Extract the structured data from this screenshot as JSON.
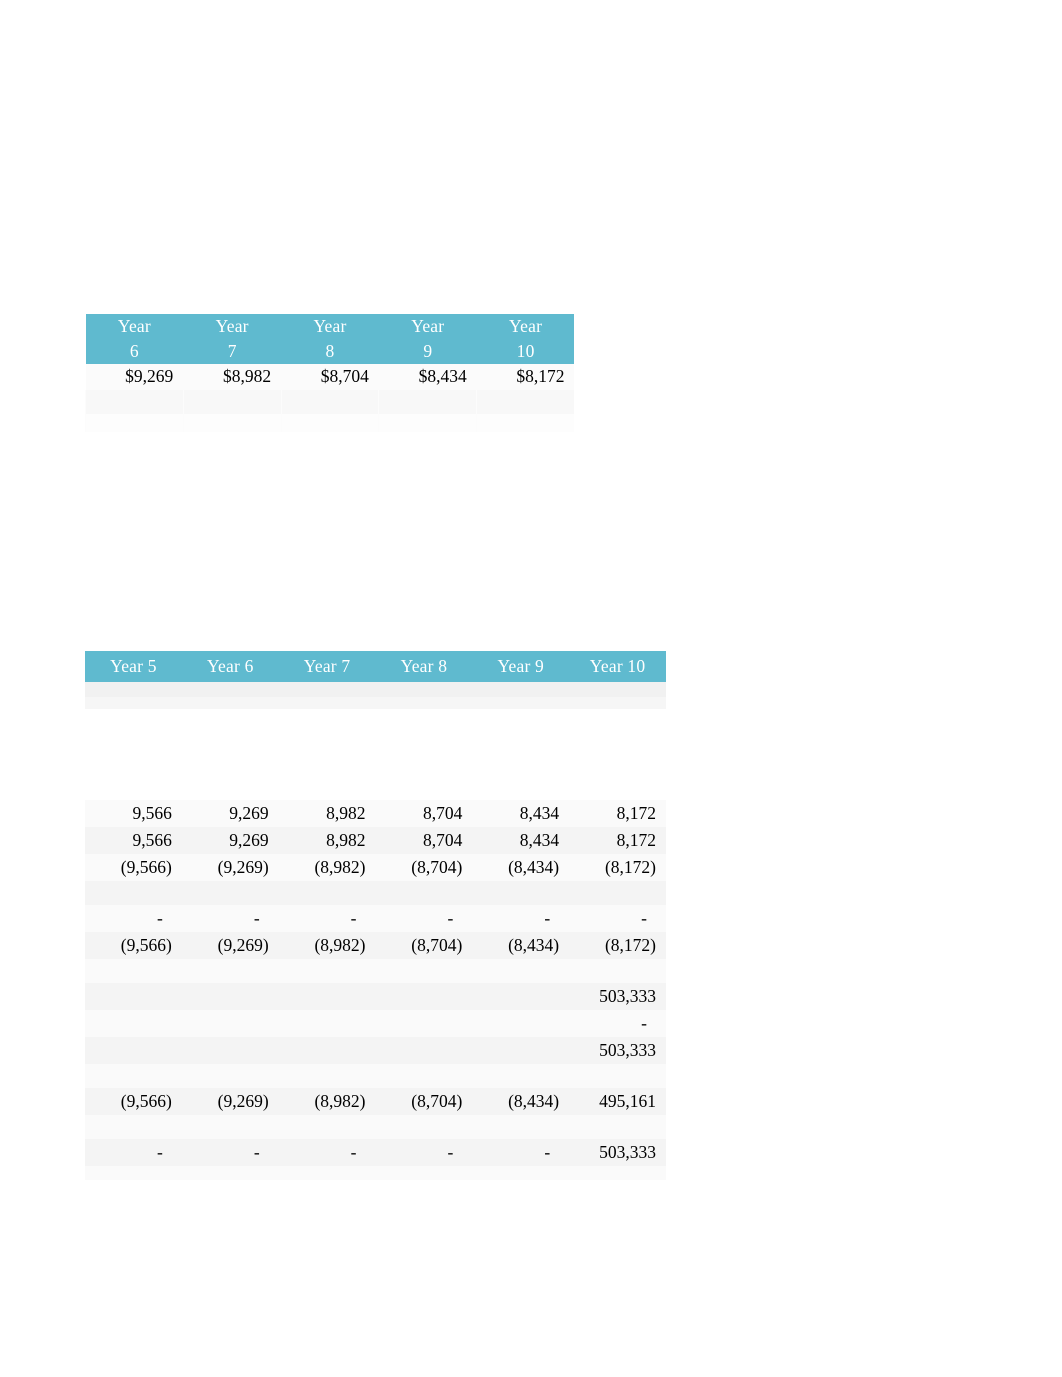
{
  "document": {
    "background_color": "#ffffff",
    "accent_color": "#5fbacf",
    "header_text_color": "#ffffff",
    "body_text_color": "#000000"
  },
  "table_one": {
    "name": "year-6-to-10-summary",
    "headers": [
      {
        "line1": "Year",
        "line2": "6"
      },
      {
        "line1": "Year",
        "line2": "7"
      },
      {
        "line1": "Year",
        "line2": "8"
      },
      {
        "line1": "Year",
        "line2": "9"
      },
      {
        "line1": "Year",
        "line2": "10"
      }
    ],
    "rows": [
      {
        "name": "amount-row",
        "values": [
          "$9,269",
          "$8,982",
          "$8,704",
          "$8,434",
          "$8,172"
        ]
      },
      {
        "name": "blank-row-1",
        "values": [
          "",
          "",
          "",
          "",
          ""
        ]
      },
      {
        "name": "blank-row-2",
        "values": [
          "",
          "",
          "",
          "",
          ""
        ]
      }
    ]
  },
  "table_two": {
    "name": "cash-flow-detail",
    "headers": [
      "Year 5",
      "Year 6",
      "Year 7",
      "Year 8",
      "Year 9",
      "Year 10"
    ],
    "rows": [
      {
        "name": "row-gross-1",
        "values": [
          "9,566",
          "9,269",
          "8,982",
          "8,704",
          "8,434",
          "8,172"
        ]
      },
      {
        "name": "row-gross-2",
        "values": [
          "9,566",
          "9,269",
          "8,982",
          "8,704",
          "8,434",
          "8,172"
        ]
      },
      {
        "name": "row-negative-1",
        "values": [
          "(9,566)",
          "(9,269)",
          "(8,982)",
          "(8,704)",
          "(8,434)",
          "(8,172)"
        ]
      },
      {
        "name": "row-blank-1",
        "values": [
          "",
          "",
          "",
          "",
          "",
          ""
        ]
      },
      {
        "name": "row-dashes-1",
        "values": [
          "-",
          "-",
          "-",
          "-",
          "-",
          "-"
        ]
      },
      {
        "name": "row-negative-2",
        "values": [
          "(9,566)",
          "(9,269)",
          "(8,982)",
          "(8,704)",
          "(8,434)",
          "(8,172)"
        ]
      },
      {
        "name": "row-blank-2",
        "values": [
          "",
          "",
          "",
          "",
          "",
          ""
        ]
      },
      {
        "name": "row-terminal-value",
        "values": [
          "",
          "",
          "",
          "",
          "",
          "503,333"
        ]
      },
      {
        "name": "row-terminal-dash",
        "values": [
          "",
          "",
          "",
          "",
          "",
          "-"
        ]
      },
      {
        "name": "row-terminal-total",
        "values": [
          "",
          "",
          "",
          "",
          "",
          "503,333"
        ]
      },
      {
        "name": "row-blank-3",
        "values": [
          "",
          "",
          "",
          "",
          "",
          ""
        ]
      },
      {
        "name": "row-net-cash-flow",
        "values": [
          "(9,566)",
          "(9,269)",
          "(8,982)",
          "(8,704)",
          "(8,434)",
          "495,161"
        ]
      },
      {
        "name": "row-blank-4",
        "values": [
          "",
          "",
          "",
          "",
          "",
          ""
        ]
      },
      {
        "name": "row-final-total",
        "values": [
          "-",
          "-",
          "-",
          "-",
          "-",
          "503,333"
        ]
      }
    ]
  }
}
